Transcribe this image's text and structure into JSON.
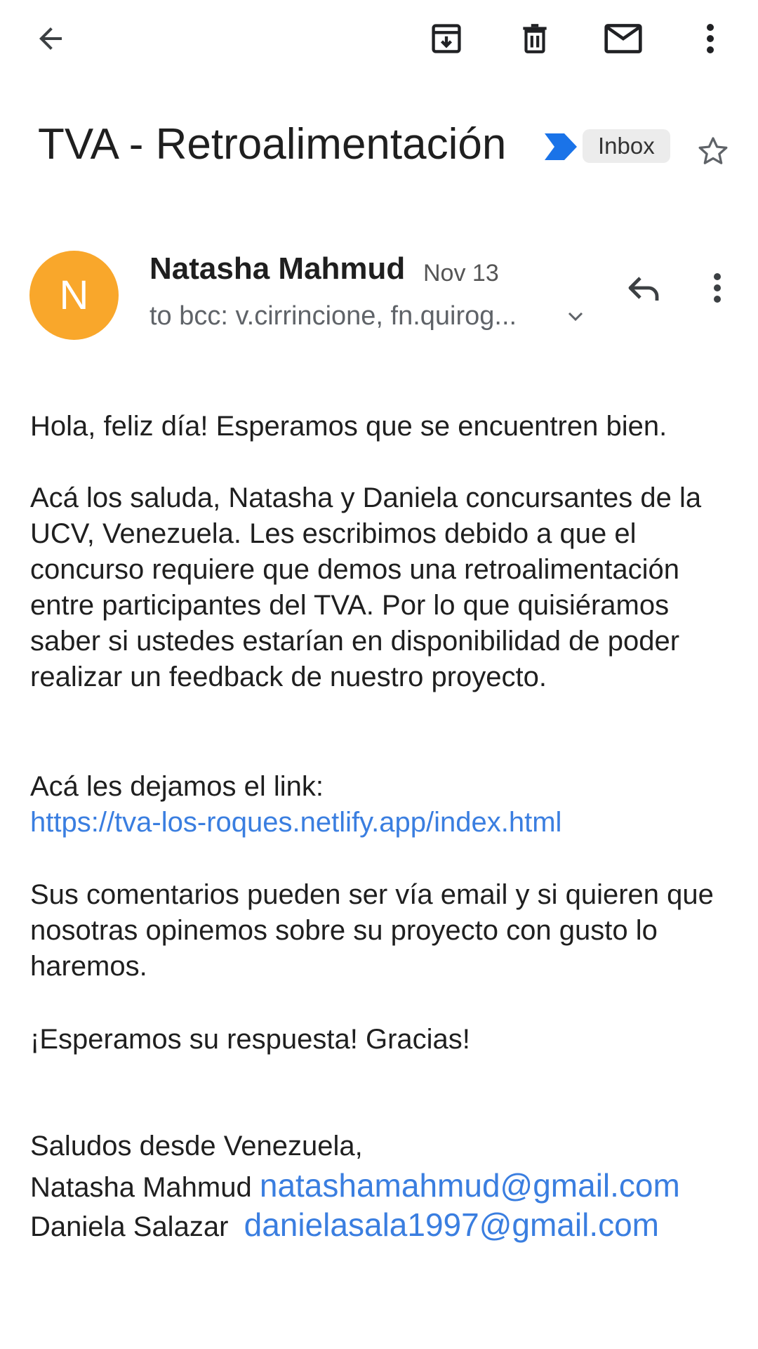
{
  "toolbar": {
    "icons": {
      "back": "arrow-back-icon",
      "archive": "archive-icon",
      "delete": "trash-icon",
      "mark_unread": "mail-icon",
      "more": "more-vert-icon"
    }
  },
  "subject": {
    "title": "TVA - Retroalimentación",
    "label": "Inbox",
    "label_icon": "important-label-icon",
    "star_icon": "star-outline-icon"
  },
  "message": {
    "avatar_initial": "N",
    "avatar_color": "#f9a72b",
    "sender": "Natasha Mahmud",
    "date": "Nov 13",
    "recipients": "to bcc: v.cirrincione, fn.quirog...",
    "reply_icon": "reply-icon",
    "more_icon": "more-vert-icon",
    "expand_icon": "chevron-down-icon"
  },
  "body": {
    "greeting": "Hola, feliz día! Esperamos que se encuentren bien.",
    "paragraph1": "Acá los saluda, Natasha y Daniela concursantes de la UCV, Venezuela. Les escribimos debido a que el concurso requiere que demos una retroalimentación entre participantes del TVA. Por lo que quisiéramos saber si ustedes estarían en disponibilidad de poder realizar un feedback de nuestro proyecto.",
    "link_intro": "Acá les dejamos el link:",
    "link": "https://tva-los-roques.netlify.app/index.html",
    "paragraph2": "Sus comentarios pueden ser vía email y si quieren que nosotras opinemos sobre su proyecto con gusto lo haremos.",
    "closing": "¡Esperamos su respuesta! Gracias!",
    "signature": {
      "line1": "Saludos desde Venezuela,",
      "name1": "Natasha Mahmud",
      "email1": "natashamahmud@gmail.com",
      "name2": "Daniela Salazar",
      "email2": "danielasala1997@gmail.com"
    }
  },
  "colors": {
    "link": "#3a7ee0",
    "label_arrow": "#1a73e8",
    "text": "#1f1f1f",
    "secondary_text": "#5f6368"
  }
}
